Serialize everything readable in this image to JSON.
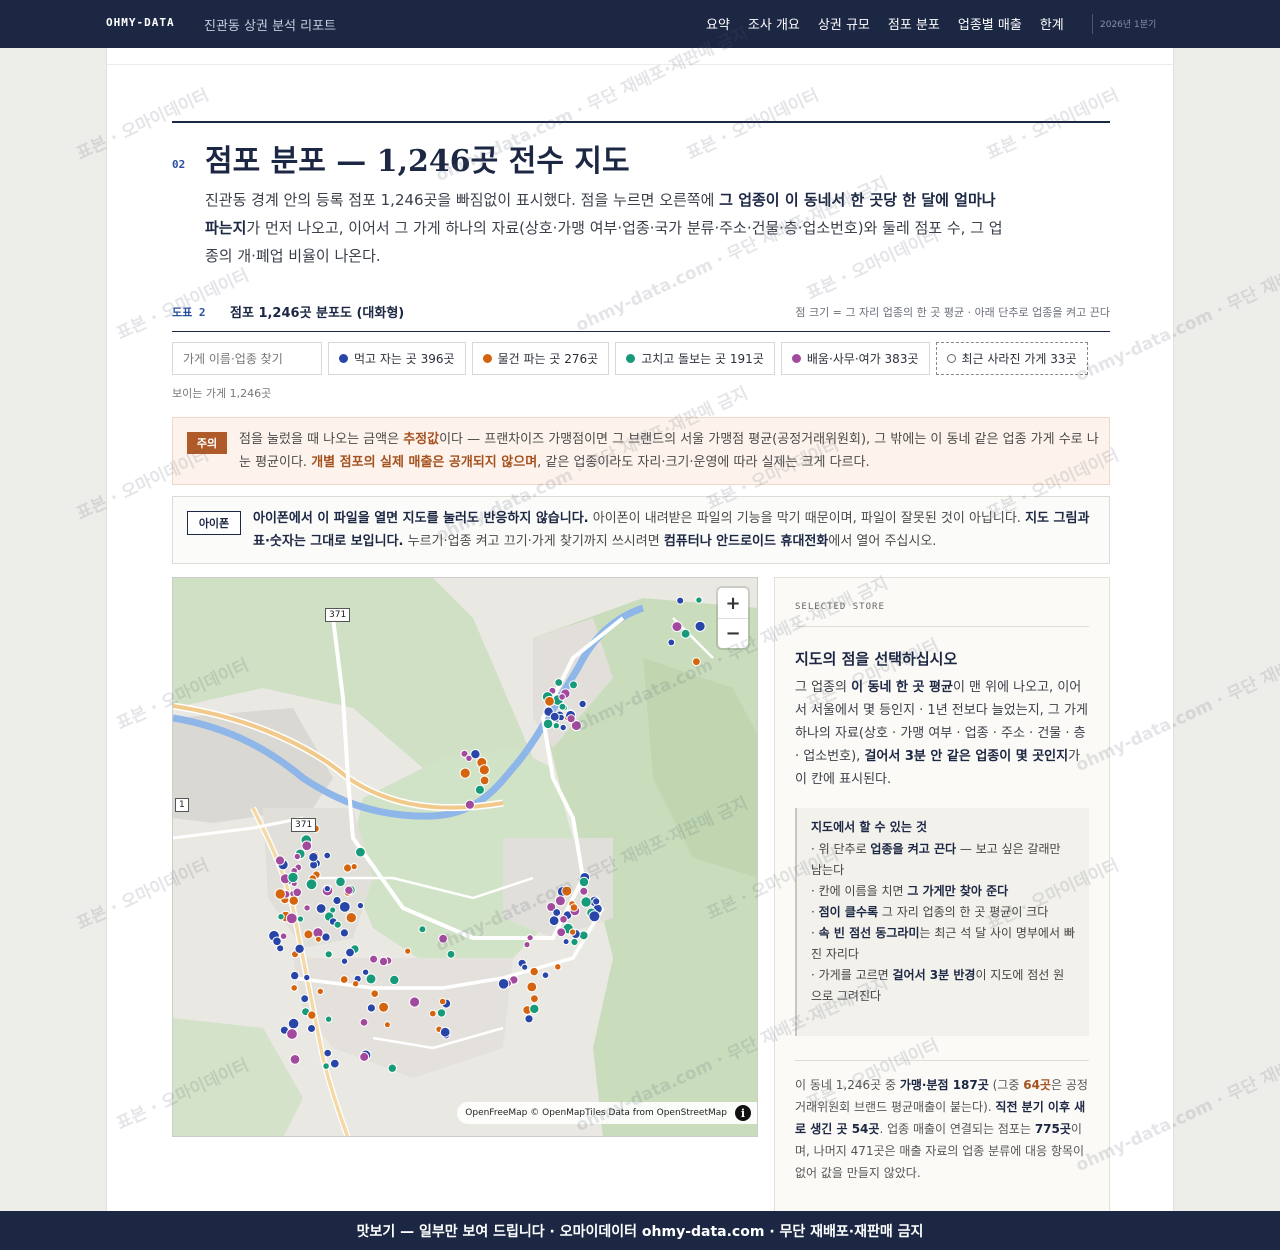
{
  "nav": {
    "brand": "OHMY-DATA",
    "subtitle": "진관동 상권 분석 리포트",
    "items": [
      "요약",
      "조사 개요",
      "상권 규모",
      "점포 분포",
      "업종별 매출",
      "한계"
    ],
    "period": "2026년 1분기"
  },
  "section": {
    "number": "02",
    "title": "점포 분포 — 1,246곳 전수 지도",
    "lead_1": "진관동 경계 안의 등록 점포 1,246곳을 빠짐없이 표시했다. 점을 누르면 오른쪽에 ",
    "lead_bold": "그 업종이 이 동네서 한 곳당 한 달에 얼마나 파는지",
    "lead_2": "가 먼저 나오고, 이어서 그 가게 하나의 자료(상호·가맹 여부·업종·국가 분류·주소·건물·층·업소번호)와 둘레 점포 수, 그 업종의 개·폐업 비율이 나온다."
  },
  "figure": {
    "number": "도표 2",
    "title": "점포 1,246곳 분포도 (대화형)",
    "note": "점 크기 = 그 자리 업종의 한 곳 평균 · 아래 단추로 업종을 켜고 끈다"
  },
  "filters": {
    "search_placeholder": "가게 이름·업종 찾기",
    "chips": [
      {
        "label": "먹고 자는 곳 396곳",
        "color": "#2845a8"
      },
      {
        "label": "물건 파는 곳 276곳",
        "color": "#d4650e"
      },
      {
        "label": "고치고 돌보는 곳 191곳",
        "color": "#179a7a"
      },
      {
        "label": "배움·사무·여가 383곳",
        "color": "#a24a9e"
      }
    ],
    "closed_chip": "최근 사라진 가게 33곳",
    "visible_count": "보이는 가게 1,246곳"
  },
  "notice": {
    "tag": "주의",
    "t1": "점을 눌렀을 때 나오는 금액은 ",
    "b1": "추정값",
    "t2": "이다 — 프랜차이즈 가맹점이면 그 브랜드의 서울 가맹점 평균(공정거래위원회), 그 밖에는 이 동네 같은 업종 가게 수로 나눈 평균이다. ",
    "b2": "개별 점포의 실제 매출은 공개되지 않으며",
    "t3": ", 같은 업종이라도 자리·크기·운영에 따라 실제는 크게 다르다."
  },
  "iphone": {
    "tag": "아이폰",
    "b1": "아이폰에서 이 파일을 열면 지도를 눌러도 반응하지 않습니다.",
    "t1": " 아이폰이 내려받은 파일의 기능을 막기 때문이며, 파일이 잘못된 것이 아닙니다. ",
    "b2": "지도 그림과 표·숫자는 그대로 보입니다.",
    "t2": " 누르기·업종 켜고 끄기·가게 찾기까지 쓰시려면 ",
    "b3": "컴퓨터나 안드로이드 휴대전화",
    "t3": "에서 열어 주십시오."
  },
  "map": {
    "zoom_in": "+",
    "zoom_out": "−",
    "attribution": "OpenFreeMap © OpenMapTiles Data from OpenStreetMap",
    "info": "i",
    "road_labels": [
      "371",
      "371",
      "1"
    ]
  },
  "side": {
    "eyebrow": "SELECTED STORE",
    "heading": "지도의 점을 선택하십시오",
    "d1": "그 업종의 ",
    "db1": "이 동네 한 곳 평균",
    "d2": "이 맨 위에 나오고, 이어서 서울에서 몇 등인지 · 1년 전보다 늘었는지, 그 가게 하나의 자료(상호 · 가맹 여부 · 업종 · 주소 · 건물 · 층 · 업소번호), ",
    "db2": "걸어서 3분 안 같은 업종이 몇 곳인지",
    "d3": "가 이 칸에 표시된다.",
    "how_title": "지도에서 할 수 있는 것",
    "how_1a": "· 위 단추로 ",
    "how_1b": "업종을 켜고 끈다",
    "how_1c": " — 보고 싶은 갈래만 남는다",
    "how_2a": "· 칸에 이름을 치면 ",
    "how_2b": "그 가게만 찾아 준다",
    "how_3a": "· ",
    "how_3b": "점이 클수록",
    "how_3c": " 그 자리 업종의 한 곳 평균이 크다",
    "how_4a": "· ",
    "how_4b": "속 빈 점선 동그라미",
    "how_4c": "는 최근 석 달 사이 명부에서 빠진 자리다",
    "how_5a": "· 가게를 고르면 ",
    "how_5b": "걸어서 3분 반경",
    "how_5c": "이 지도에 점선 원으로 그려진다",
    "s1": "이 동네 1,246곳 중 ",
    "sb1": "가맹·분점 187곳",
    "s2": " (그중 ",
    "so1": "64곳",
    "s3": "은 공정거래위원회 브랜드 평균매출이 붙는다). ",
    "sb2": "직전 분기 이후 새로 생긴 곳 54곳",
    "s4": ". 업종 매출이 연결되는 점포는 ",
    "sb3": "775곳",
    "s5": "이며, 나머지 471곳은 매출 자료의 업종 분류에 대응 항목이 없어 값을 만들지 않았다."
  },
  "watermark": {
    "a": "표본 · 오마이데이터",
    "b": "ohmy-data.com · 무단 재배포·재판매 금지"
  },
  "footer": "맛보기 — 일부만 보여 드립니다 · 오마이데이터 ohmy-data.com · 무단 재배포·재판매 금지"
}
